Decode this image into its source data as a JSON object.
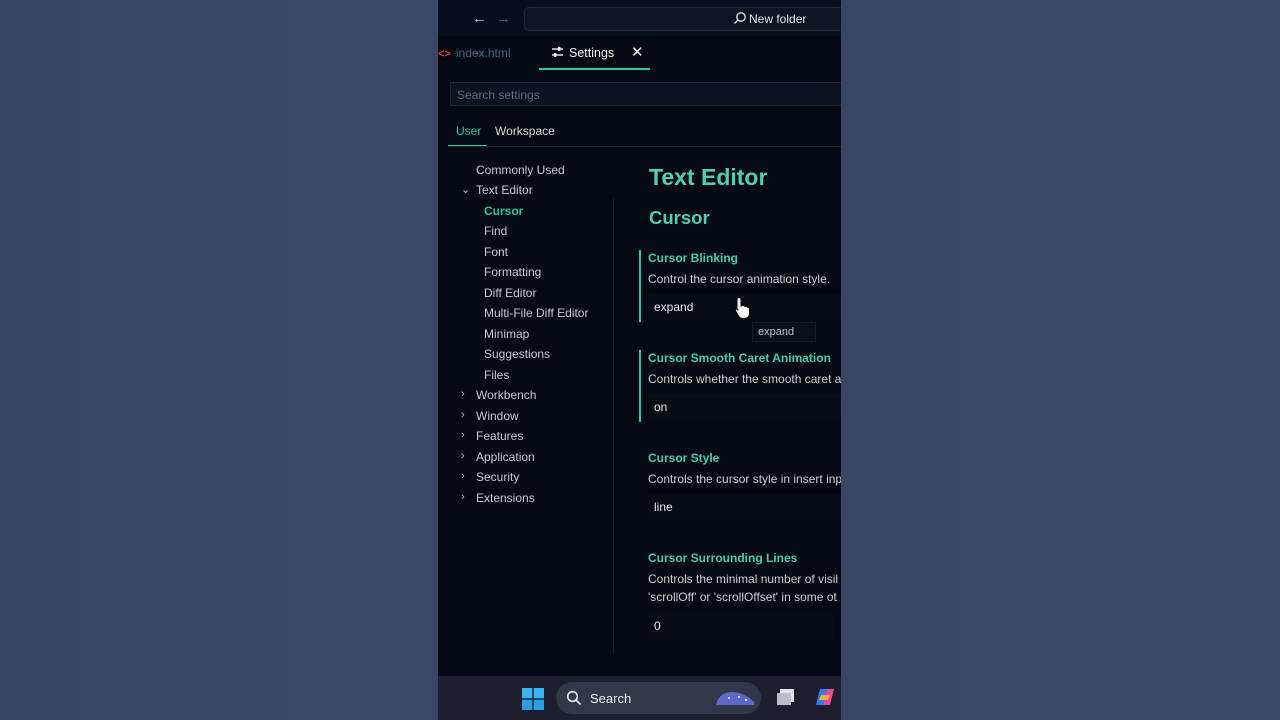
{
  "titlebar": {
    "back_icon": "arrow-left-icon",
    "forward_icon": "arrow-right-icon",
    "command_label": "New folder"
  },
  "editor_tabs": [
    {
      "label": "index.html",
      "icon": "html-code-icon"
    },
    {
      "label": "Settings",
      "icon": "settings-sliders-icon",
      "close_icon": "close-icon"
    }
  ],
  "search": {
    "placeholder": "Search settings",
    "value": ""
  },
  "scope_tabs": {
    "user": "User",
    "workspace": "Workspace"
  },
  "tree": {
    "commonly_used": "Commonly Used",
    "text_editor": "Text Editor",
    "children": [
      "Cursor",
      "Find",
      "Font",
      "Formatting",
      "Diff Editor",
      "Multi-File Diff Editor",
      "Minimap",
      "Suggestions",
      "Files"
    ],
    "groups": [
      "Workbench",
      "Window",
      "Features",
      "Application",
      "Security",
      "Extensions"
    ]
  },
  "content": {
    "heading": "Text Editor",
    "subheading": "Cursor",
    "settings": [
      {
        "title": "Cursor Blinking",
        "desc": "Control the cursor animation style.",
        "value": "expand"
      },
      {
        "title": "Cursor Smooth Caret Animation",
        "desc": "Controls whether the smooth caret a",
        "value": "on"
      },
      {
        "title": "Cursor Style",
        "desc": "Controls the cursor style in insert inp",
        "value": "line"
      },
      {
        "title": "Cursor Surrounding Lines",
        "desc": "Controls the minimal number of visil",
        "desc2": "'scrollOff' or 'scrollOffset' in some ot",
        "value": "0"
      }
    ],
    "tooltip": "expand"
  },
  "taskbar": {
    "search_label": "Search",
    "start_icon": "windows-start-icon",
    "search_icon": "search-icon",
    "app1_icon": "file-explorer-icon",
    "app2_icon": "copilot-icon"
  },
  "colors": {
    "accent": "#2cc7a2",
    "heading": "#4fd0b5",
    "background": "#050a12",
    "desktop": "#3a4564"
  }
}
